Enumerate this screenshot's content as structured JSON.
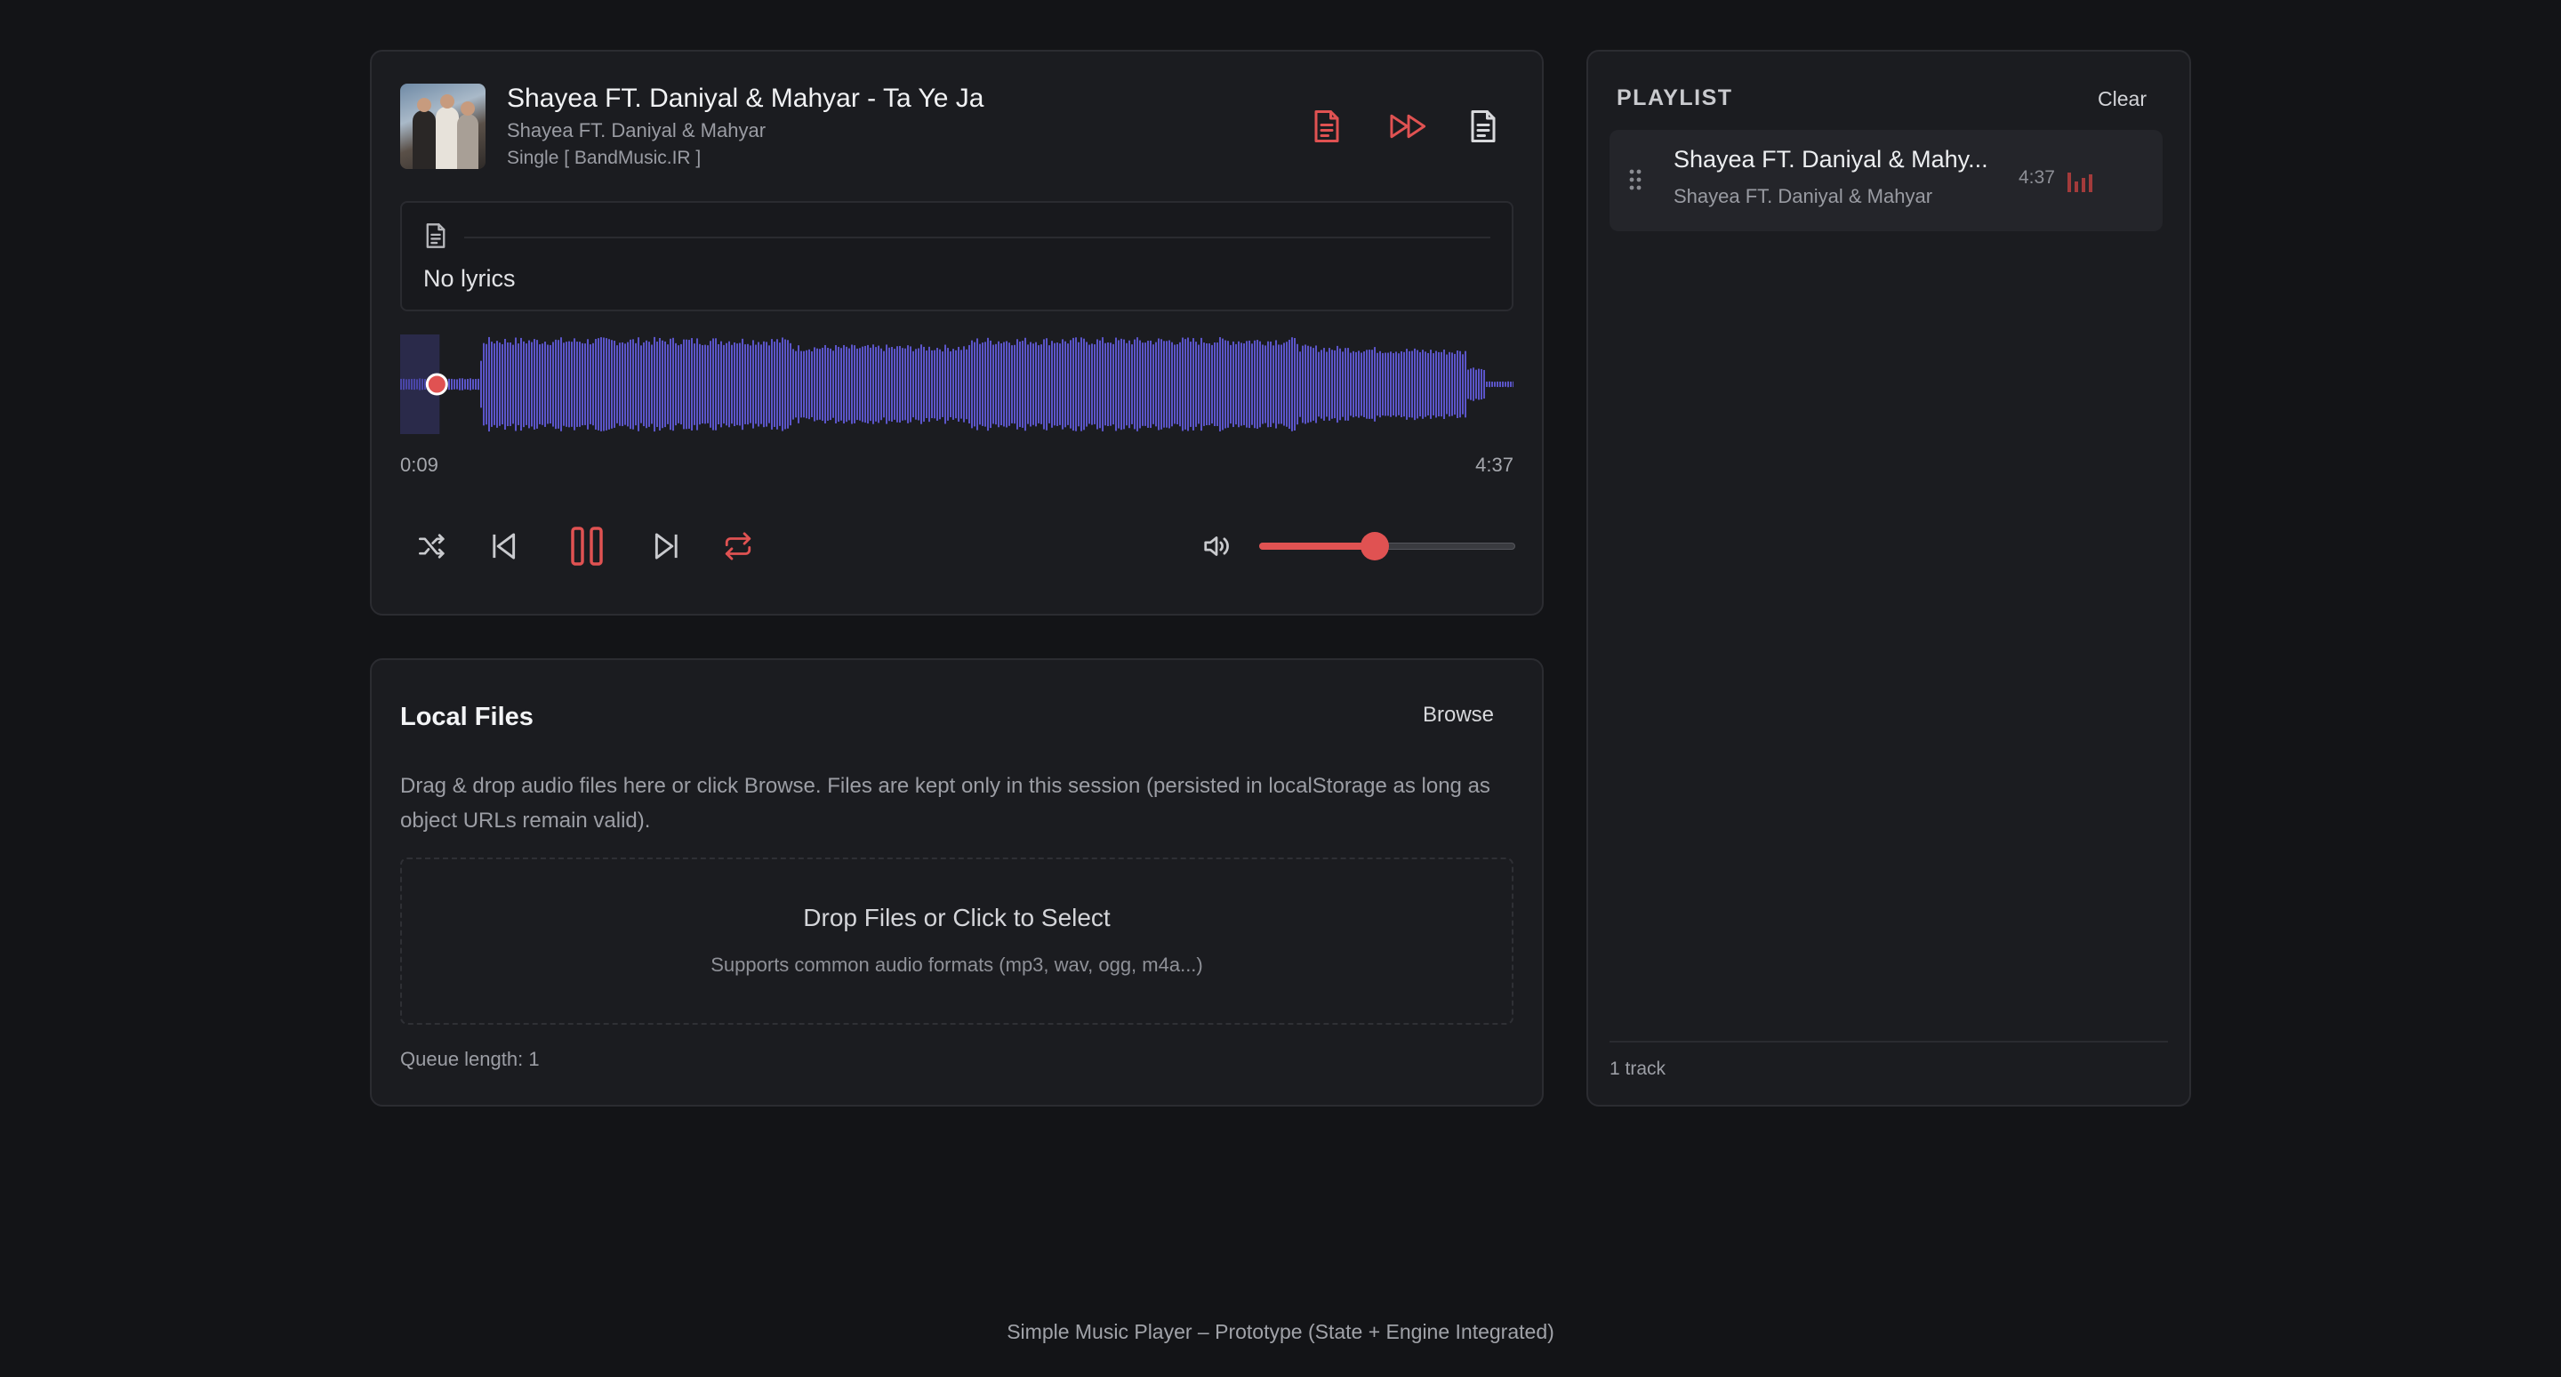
{
  "player": {
    "track_title": "Shayea FT. Daniyal & Mahyar - Ta Ye Ja",
    "artist": "Shayea FT. Daniyal & Mahyar",
    "album": "Single [ BandMusic.IR ]",
    "lyrics_text": "No lyrics",
    "current_time": "0:09",
    "duration": "4:37",
    "progress_fraction": 0.033,
    "volume_fraction": 0.45,
    "accent_color": "#e05252",
    "waveform_color": "#5b55c9"
  },
  "header_icons": [
    "lyrics-document-icon",
    "fast-forward-icon",
    "document-icon"
  ],
  "controls": [
    "shuffle-icon",
    "previous-icon",
    "pause-icon",
    "next-icon",
    "repeat-icon",
    "volume-icon"
  ],
  "local_files": {
    "title": "Local Files",
    "browse_label": "Browse",
    "description": "Drag & drop audio files here or click Browse. Files are kept only in this session (persisted in localStorage as long as object URLs remain valid).",
    "drop_title": "Drop Files or Click to Select",
    "drop_subtitle": "Supports common audio formats (mp3, wav, ogg, m4a...)",
    "queue_length": "Queue length: 1"
  },
  "playlist": {
    "title": "PLAYLIST",
    "clear_label": "Clear",
    "items": [
      {
        "title": "Shayea FT. Daniyal & Mahy...",
        "artist": "Shayea FT. Daniyal & Mahyar",
        "duration": "4:37"
      }
    ],
    "count_label": "1 track"
  },
  "footer": "Simple Music Player – Prototype (State + Engine Integrated)"
}
